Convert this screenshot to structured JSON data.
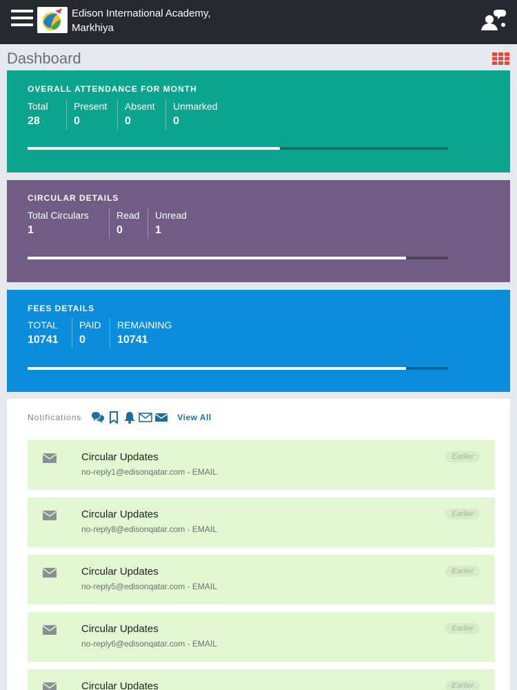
{
  "header": {
    "school_name_line1": "Edison International Academy,",
    "school_name_line2": "Markhiya",
    "menu_icon": "hamburger-menu-icon",
    "user_icon": "user-switch-icon"
  },
  "page": {
    "title": "Dashboard",
    "grid_icon": "grid-apps-icon"
  },
  "attendance": {
    "title": "OVERALL ATTENDANCE FOR  MONTH",
    "color": "#0aa48f",
    "stats": [
      {
        "label": "Total",
        "value": "28"
      },
      {
        "label": "Present",
        "value": "0"
      },
      {
        "label": "Absent",
        "value": "0"
      },
      {
        "label": "Unmarked",
        "value": "0"
      }
    ],
    "progress": 0.6
  },
  "circulars": {
    "title": "CIRCULAR DETAILS",
    "color": "#715c85",
    "stats": [
      {
        "label": "Total Circulars",
        "value": "1"
      },
      {
        "label": "Read",
        "value": "0"
      },
      {
        "label": "Unread",
        "value": "1"
      }
    ],
    "progress": 0.9
  },
  "fees": {
    "title": "FEES  DETAILS",
    "color": "#0a8edb",
    "stats": [
      {
        "label": "TOTAL",
        "value": "10741"
      },
      {
        "label": "PAID",
        "value": "0"
      },
      {
        "label": "REMAINING",
        "value": "10741"
      }
    ],
    "progress": 0.9
  },
  "notifications": {
    "label": "Notifications",
    "view_all": "View All",
    "filter_icons": [
      "chat-icon",
      "bookmark-icon",
      "bell-icon",
      "envelope-outline-icon",
      "envelope-icon"
    ],
    "items": [
      {
        "title": "Circular Updates",
        "sender": "no-reply1@edisonqatar.com - EMAIL",
        "badge": "Earlier",
        "icon": "envelope-icon"
      },
      {
        "title": "Circular Updates",
        "sender": "no-reply8@edisonqatar.com - EMAIL",
        "badge": "Earlier",
        "icon": "envelope-icon"
      },
      {
        "title": "Circular Updates",
        "sender": "no-reply5@edisonqatar.com - EMAIL",
        "badge": "Earlier",
        "icon": "envelope-icon"
      },
      {
        "title": "Circular Updates",
        "sender": "no-reply6@edisonqatar.com - EMAIL",
        "badge": "Earlier",
        "icon": "envelope-icon"
      },
      {
        "title": "Circular Updates",
        "sender": "",
        "badge": "Earlier",
        "icon": "envelope-icon"
      }
    ]
  }
}
